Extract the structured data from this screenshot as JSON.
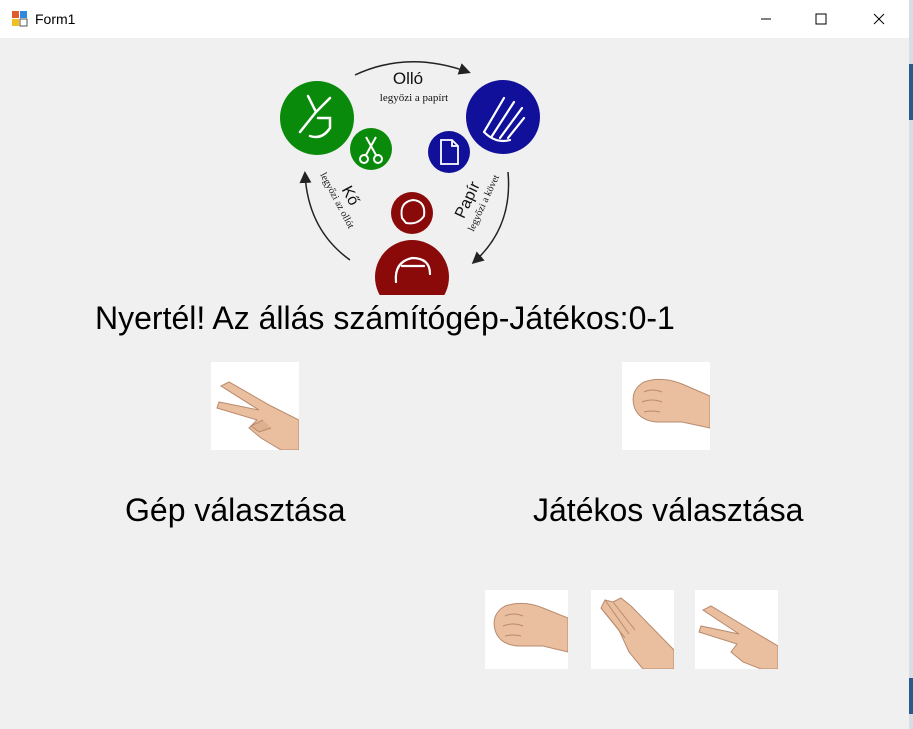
{
  "window": {
    "title": "Form1"
  },
  "diagram": {
    "arrow_top_title": "Olló",
    "arrow_top_sub": "legyőzi a papírt",
    "arrow_right_title": "Papír",
    "arrow_right_sub": "legyőzi a követ",
    "arrow_left_title": "Kő",
    "arrow_left_sub": "legyőzi az ollót",
    "colors": {
      "scissors": "#0a8a0a",
      "paper": "#10109a",
      "rock": "#8a0a0a"
    }
  },
  "main": {
    "status": "Nyertél! Az állás számítógép-Játékos:0-1",
    "computer_label": "Gép választása",
    "player_label": "Játékos választása",
    "computer_choice_icon": "scissors-hand-icon",
    "player_choice_icon": "rock-hand-icon"
  },
  "choices": [
    {
      "icon": "rock-hand-icon"
    },
    {
      "icon": "paper-hand-icon"
    },
    {
      "icon": "scissors-hand-icon"
    }
  ]
}
